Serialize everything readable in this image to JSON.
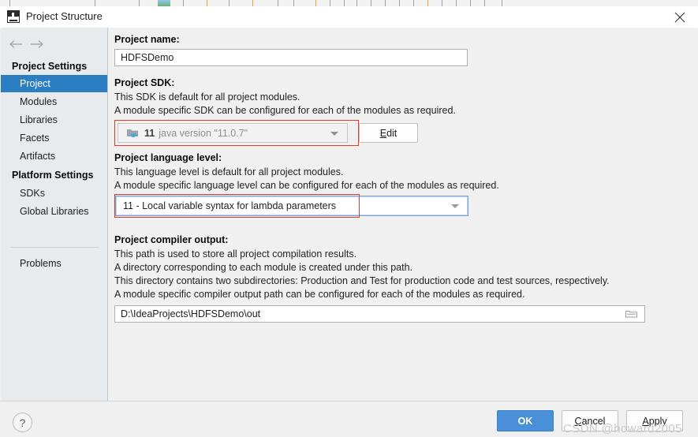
{
  "window": {
    "title": "Project Structure",
    "app_icon": "intellij-idea-icon",
    "close_icon": "close-icon"
  },
  "sidebar": {
    "back_icon": "arrow-left-icon",
    "forward_icon": "arrow-right-icon",
    "groups": [
      {
        "label": "Project Settings",
        "items": [
          {
            "label": "Project",
            "selected": true
          },
          {
            "label": "Modules",
            "selected": false
          },
          {
            "label": "Libraries",
            "selected": false
          },
          {
            "label": "Facets",
            "selected": false
          },
          {
            "label": "Artifacts",
            "selected": false
          }
        ]
      },
      {
        "label": "Platform Settings",
        "items": [
          {
            "label": "SDKs",
            "selected": false
          },
          {
            "label": "Global Libraries",
            "selected": false
          }
        ]
      }
    ],
    "problems": {
      "label": "Problems"
    }
  },
  "main": {
    "project_name": {
      "title": "Project name:",
      "value": "HDFSDemo"
    },
    "project_sdk": {
      "title": "Project SDK:",
      "desc1": "This SDK is default for all project modules.",
      "desc2": "A module specific SDK can be configured for each of the modules as required.",
      "icon": "java-sdk-icon",
      "version": "11",
      "description": "java version \"11.0.7\"",
      "dropdown_icon": "chevron-down-icon",
      "edit_button": {
        "mnemonic": "E",
        "rest": "dit"
      }
    },
    "language_level": {
      "title": "Project language level:",
      "desc1": "This language level is default for all project modules.",
      "desc2": "A module specific language level can be configured for each of the modules as required.",
      "value": "11 - Local variable syntax for lambda parameters",
      "dropdown_icon": "chevron-down-icon"
    },
    "compiler_output": {
      "title": "Project compiler output:",
      "desc1": "This path is used to store all project compilation results.",
      "desc2": "A directory corresponding to each module is created under this path.",
      "desc3": "This directory contains two subdirectories: Production and Test for production code and test sources, respectively.",
      "desc4": "A module specific compiler output path can be configured for each of the modules as required.",
      "value": "D:\\IdeaProjects\\HDFSDemo\\out",
      "browse_icon": "folder-browse-icon"
    }
  },
  "footer": {
    "help_icon": "question-mark-icon",
    "ok": "OK",
    "cancel": {
      "mnemonic": "C",
      "rest": "ancel"
    },
    "apply": {
      "mnemonic": "A",
      "rest": "pply"
    }
  },
  "annotations": {
    "watermark": "CSDN @howard2005",
    "highlight_color": "#e8362c"
  }
}
